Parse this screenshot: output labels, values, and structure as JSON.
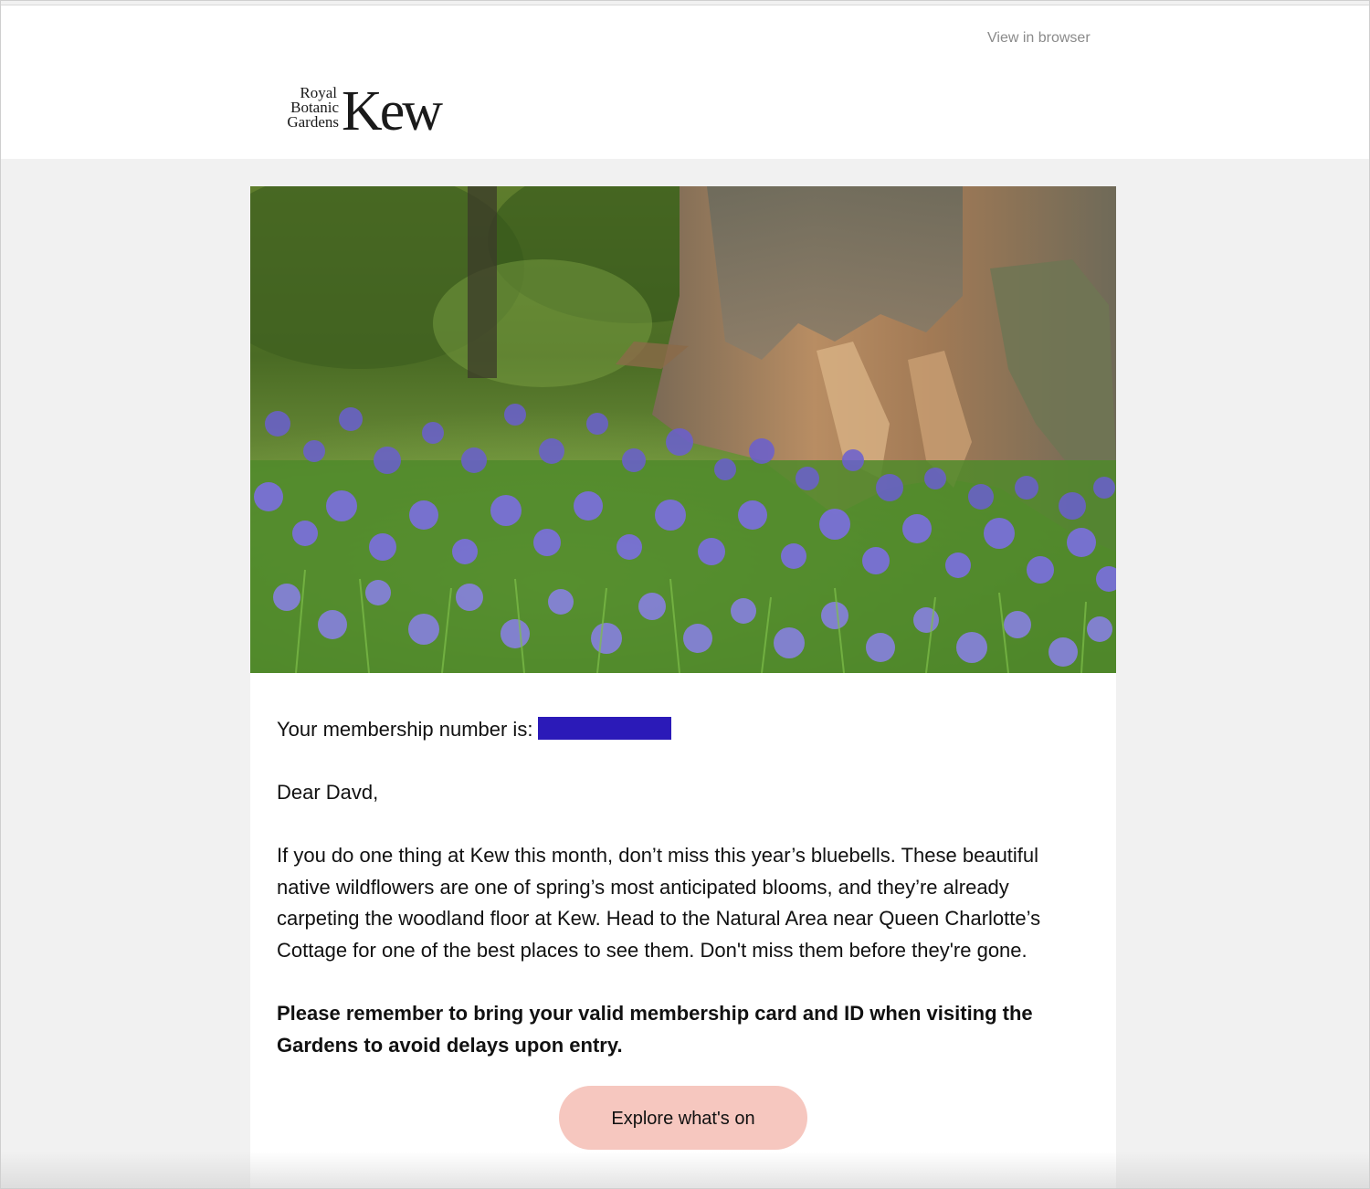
{
  "header": {
    "view_in_browser": "View in browser",
    "logo": {
      "line1": "Royal",
      "line2": "Botanic",
      "line3": "Gardens",
      "wordmark": "Kew"
    }
  },
  "hero": {
    "image": "bluebell-woodland-photo"
  },
  "content": {
    "membership_label": "Your membership number is:",
    "greeting": "Dear Davd,",
    "body": "If you do one thing at Kew this month, don’t miss this year’s bluebells. These beautiful native wildflowers are one of spring’s most anticipated blooms, and they’re already carpeting the woodland floor at Kew. Head to the Natural Area near Queen Charlotte’s Cottage for one of the best places to see them. Don't miss them before they're gone.",
    "notice": "Please remember to bring your valid membership card and ID when visiting the Gardens to avoid delays upon entry."
  },
  "cta": {
    "label": "Explore what's on"
  },
  "colors": {
    "redaction": "#2b1ab8",
    "cta_bg": "#f6c7bf",
    "page_bg": "#f1f1f1"
  }
}
